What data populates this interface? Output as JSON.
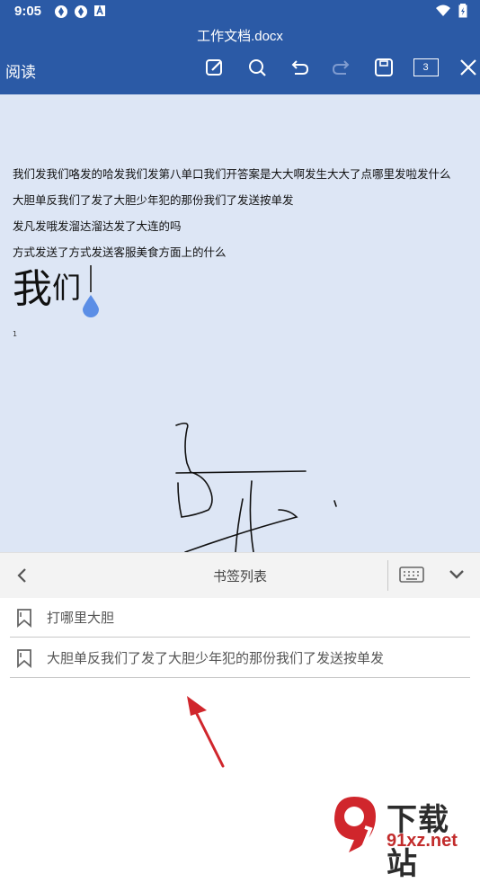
{
  "status_bar": {
    "time": "9:05"
  },
  "header": {
    "title": "工作文档.docx",
    "mode_label": "阅读",
    "page_count": "3"
  },
  "document": {
    "lines": [
      "我们发我们咯发的哈发我们发第八单口我们开答案是大大啊发生大大了点哪里发啦发什么",
      "大胆单反我们了发了大胆少年犯的那份我们了发送按单发",
      "发凡发哦发溜达溜达发了大连的吗",
      "方式发送了方式发送客服美食方面上的什么"
    ],
    "large_text_1": "我",
    "large_text_2": "们",
    "page_number": "1"
  },
  "bookmark_panel": {
    "title": "书签列表",
    "items": [
      {
        "label": "打哪里大胆"
      },
      {
        "label": "大胆单反我们了发了大胆少年犯的那份我们了发送按单发"
      }
    ]
  },
  "watermark": {
    "text": "下载站",
    "domain": "91xz.net"
  },
  "colors": {
    "header_bg": "#2b5aa6",
    "document_bg": "#dde6f5",
    "panel_bg": "#f3f3f3",
    "arrow": "#d0262c",
    "cursor_drop": "#5b8ee6"
  }
}
